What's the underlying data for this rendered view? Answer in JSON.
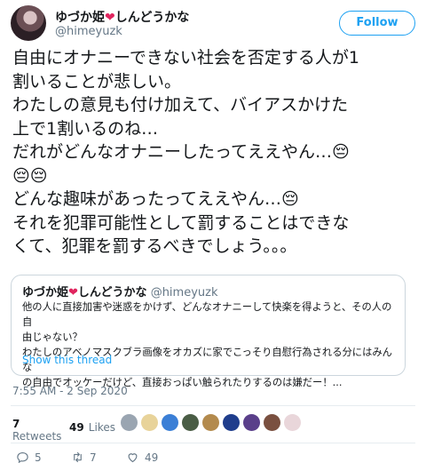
{
  "author": {
    "name_prefix": "ゆづか姫",
    "heart": "❤",
    "name_suffix": "しんどうかな",
    "handle": "@himeyuzk"
  },
  "follow_label": "Follow",
  "tweet": {
    "line1": "自由にオナニーできない社会を否定する人が1",
    "line2": "割いることが悲しい。",
    "line3": "わたしの意見も付け加えて、バイアスかけた",
    "line4": "上で1割いるのね…",
    "line5": "だれがどんなオナニーしたってええやん…😔",
    "line6": "😔😔",
    "line7": "どんな趣味があったってええやん…😔",
    "line8": "それを犯罪可能性として罰することはできな",
    "line9": "くて、犯罪を罰するべきでしょう。。。"
  },
  "quoted": {
    "name_prefix": "ゆづか姫",
    "heart": "❤",
    "name_suffix": "しんどうかな",
    "handle": "@himeyuzk",
    "line1": "他の人に直接加害や迷惑をかけず、どんなオナニーして快楽を得ようと、その人の自",
    "line2": "由じゃない？",
    "line3": "わたしのアベノマスクブラ画像をオカズに家でこっそり自慰行為される分にはみんな",
    "line4": "の自由でオッケーだけど、直接おっぱい触られたりするのは嫌だー！...",
    "show_thread": "Show this thread"
  },
  "timestamp": "7:55 AM - 2 Sep 2020",
  "stats": {
    "retweets_count": "7",
    "retweets_label": "Retweets",
    "likes_count": "49",
    "likes_label": "Likes"
  },
  "actions": {
    "reply_count": "5",
    "retweet_count": "7",
    "like_count": "49"
  },
  "colors": {
    "accent": "#1da1f2",
    "heart": "#e0245e",
    "muted": "#657786"
  }
}
